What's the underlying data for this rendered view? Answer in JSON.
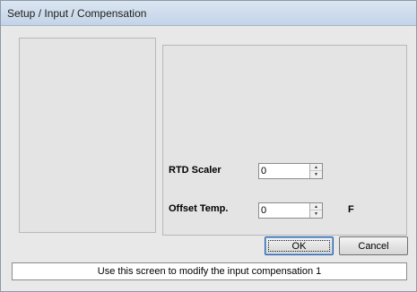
{
  "window": {
    "title": "Setup / Input / Compensation"
  },
  "fields": {
    "rtd_scaler": {
      "label": "RTD Scaler",
      "value": "0"
    },
    "offset_temp": {
      "label": "Offset Temp.",
      "value": "0",
      "unit": "F"
    }
  },
  "buttons": {
    "ok_label": "OK",
    "cancel_label": "Cancel"
  },
  "status": {
    "text": "Use this screen to modify the input compensation  1"
  },
  "icons": {
    "spin_up": "spin-up-arrow-icon",
    "spin_down": "spin-down-arrow-icon"
  }
}
